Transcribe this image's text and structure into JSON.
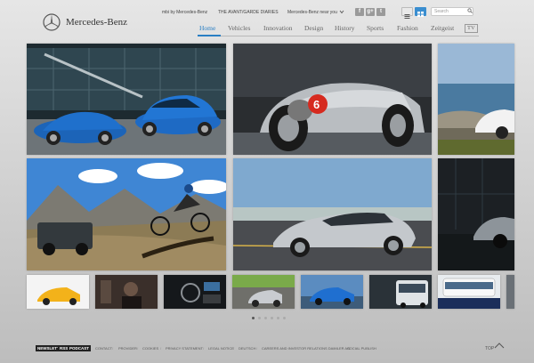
{
  "brand": {
    "name": "Mercedes-Benz"
  },
  "topbar": {
    "mbi": "mbi by Mercedes-Benz",
    "avantgarde": "THE AVANT/GARDE DIARIES",
    "near": "Mercedes-Benz near you",
    "social_labels": [
      "f",
      "g+",
      "t"
    ],
    "search_placeholder": "Search"
  },
  "nav": {
    "items": [
      "Home",
      "Vehicles",
      "Innovation",
      "Design",
      "History",
      "Sports",
      "Fashion",
      "Zeitgeist"
    ],
    "active": "Home",
    "tv": "TV"
  },
  "carousel": {
    "pages": 6,
    "current": 1
  },
  "footer": {
    "badges": [
      "NEWSLETTER",
      "RSS",
      "PODCAST"
    ],
    "links": [
      "CONTACT",
      "PROVIDER",
      "COOKIES",
      "PRIVACY STATEMENT",
      "LEGAL NOTICE",
      "DEUTSCH",
      "CAREERS AND INVESTOR RELATIONS DAIMLER AG",
      "SOCIAL PUBLISH"
    ],
    "top_label": "TOP"
  },
  "colors": {
    "accent": "#2a7fc4",
    "background": "#d6d6d6"
  },
  "icons": [
    "mercedes-star-icon",
    "search-icon",
    "grid-view-icon",
    "list-view-icon",
    "chevron-down-icon",
    "chevron-up-icon"
  ]
}
